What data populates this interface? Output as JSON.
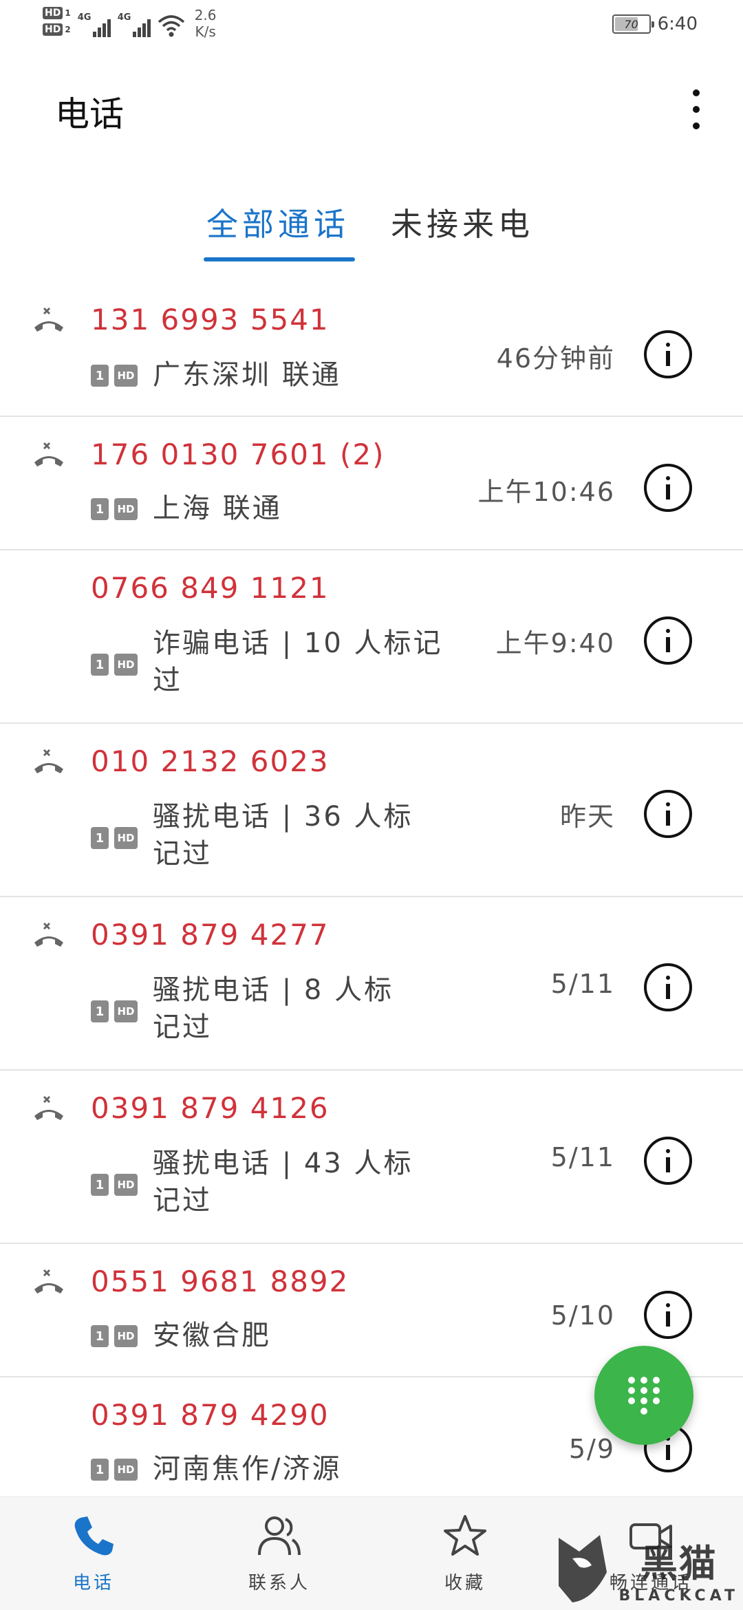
{
  "status_bar": {
    "hd1": "HD",
    "hd1_sim": "1",
    "hd2": "HD",
    "hd2_sim": "2",
    "net1": "4G",
    "net2": "4G",
    "speed_value": "2.6",
    "speed_unit": "K/s",
    "battery": "70",
    "battery_level": 0.7,
    "time": "6:40"
  },
  "appbar": {
    "title": "电话",
    "more_icon": "more-vertical-icon"
  },
  "tabs": [
    {
      "label": "全部通话",
      "active": true
    },
    {
      "label": "未接来电",
      "active": false
    }
  ],
  "colors": {
    "accent": "#1a74c9",
    "missed_number": "#d0323a",
    "fab": "#3cb54a"
  },
  "calls": [
    {
      "number": "131 6993 5541",
      "location": "广东深圳 联通",
      "time": "46分钟前",
      "missed_icon": true,
      "sim": "1",
      "hd": "HD"
    },
    {
      "number": "176 0130 7601 (2)",
      "location": "上海 联通",
      "time": "上午10:46",
      "missed_icon": true,
      "sim": "1",
      "hd": "HD"
    },
    {
      "number": "0766 849 1121",
      "location_line1": "诈骗电话 | 10 人标记",
      "location_line2": "过",
      "time": "上午9:40",
      "missed_icon": false,
      "sim": "1",
      "hd": "HD"
    },
    {
      "number": "010 2132 6023",
      "location_line1": "骚扰电话 | 36 人标",
      "location_line2": "记过",
      "time": "昨天",
      "missed_icon": true,
      "sim": "1",
      "hd": "HD"
    },
    {
      "number": "0391 879 4277",
      "location_line1": "骚扰电话 | 8 人标",
      "location_line2": "记过",
      "time": "5/11",
      "missed_icon": true,
      "sim": "1",
      "hd": "HD"
    },
    {
      "number": "0391 879 4126",
      "location_line1": "骚扰电话 | 43 人标",
      "location_line2": "记过",
      "time": "5/11",
      "missed_icon": true,
      "sim": "1",
      "hd": "HD"
    },
    {
      "number": "0551 9681 8892",
      "location": "安徽合肥",
      "time": "5/10",
      "missed_icon": true,
      "sim": "1",
      "hd": "HD"
    },
    {
      "number": "0391 879 4290",
      "location": "河南焦作/济源",
      "time": "5/9",
      "missed_icon": false,
      "sim": "1",
      "hd": "HD"
    }
  ],
  "bottom_nav": [
    {
      "label": "电话",
      "icon": "phone-icon",
      "active": true
    },
    {
      "label": "联系人",
      "icon": "contacts-icon",
      "active": false
    },
    {
      "label": "收藏",
      "icon": "star-icon",
      "active": false
    },
    {
      "label": "畅连通话",
      "icon": "video-call-icon",
      "active": false
    }
  ],
  "watermark": {
    "cn": "黑猫",
    "en": "BLACKCAT"
  }
}
